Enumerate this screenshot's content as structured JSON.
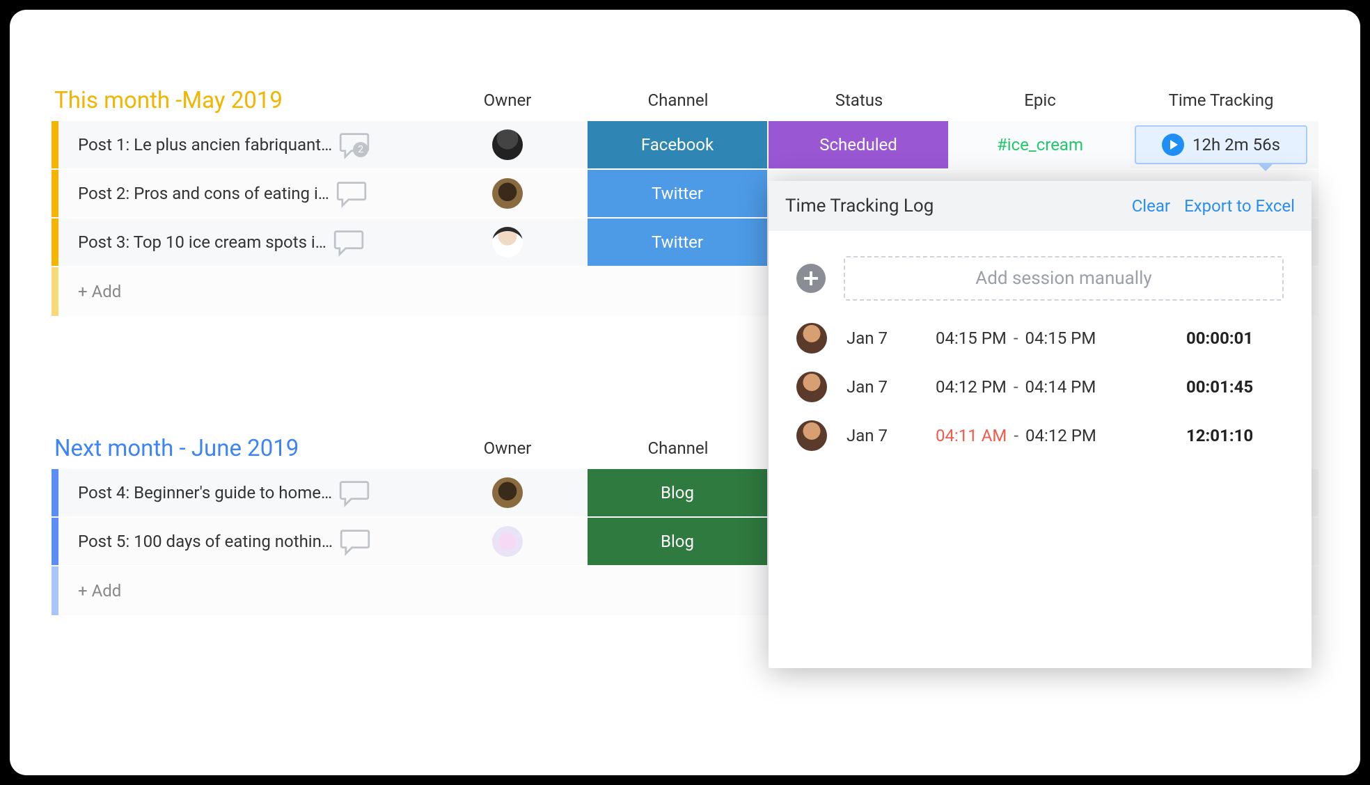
{
  "groups": [
    {
      "key": "may",
      "title": "This month -May 2019",
      "color": "yellow",
      "columns": [
        "Owner",
        "Channel",
        "Status",
        "Epic",
        "Time Tracking"
      ],
      "rows": [
        {
          "title": "Post 1: Le plus ancien fabriquant…",
          "comment_count": "2",
          "owner_avatar": "dark",
          "channel": {
            "label": "Facebook",
            "class": "c-fb"
          },
          "status": {
            "label": "Scheduled",
            "class": "c-sched"
          },
          "epic": "#ice_cream",
          "time_tracking": "12h 2m 56s"
        },
        {
          "title": "Post 2: Pros and cons of eating i…",
          "owner_avatar": "pug",
          "channel": {
            "label": "Twitter",
            "class": "c-tw"
          }
        },
        {
          "title": "Post 3: Top 10 ice cream spots i…",
          "owner_avatar": "guy",
          "channel": {
            "label": "Twitter",
            "class": "c-tw"
          }
        }
      ],
      "add_label": "+ Add"
    },
    {
      "key": "june",
      "title": "Next month - June 2019",
      "color": "blue",
      "columns": [
        "Owner",
        "Channel"
      ],
      "rows": [
        {
          "title": "Post 4: Beginner's guide to home…",
          "owner_avatar": "pug",
          "channel": {
            "label": "Blog",
            "class": "c-blog"
          }
        },
        {
          "title": "Post 5: 100 days of eating nothin…",
          "owner_avatar": "flower",
          "channel": {
            "label": "Blog",
            "class": "c-blog"
          }
        }
      ],
      "add_label": "+ Add"
    }
  ],
  "popover": {
    "title": "Time Tracking Log",
    "clear_label": "Clear",
    "export_label": "Export to Excel",
    "add_session_label": "Add session manually",
    "sessions": [
      {
        "date": "Jan 7",
        "start": "04:15 PM",
        "end": "04:15 PM",
        "duration": "00:00:01",
        "highlight_start": false
      },
      {
        "date": "Jan 7",
        "start": "04:12 PM",
        "end": "04:14 PM",
        "duration": "00:01:45",
        "highlight_start": false
      },
      {
        "date": "Jan 7",
        "start": "04:11 AM",
        "end": "04:12 PM",
        "duration": "12:01:10",
        "highlight_start": true
      }
    ]
  }
}
